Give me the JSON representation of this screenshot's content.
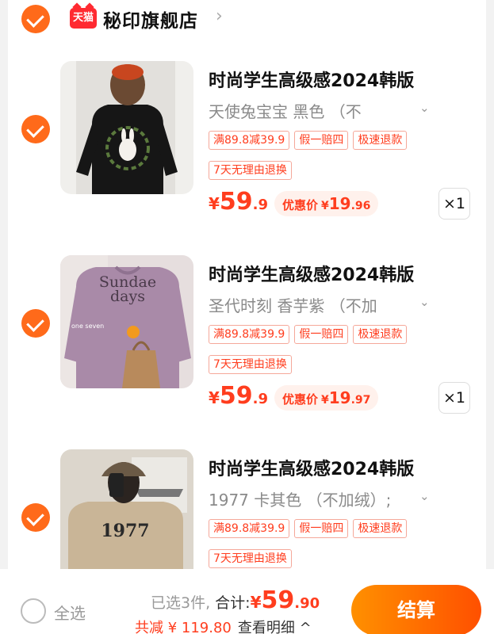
{
  "shop": {
    "name": "秘印旗舰店",
    "logo_text": "天猫"
  },
  "items": [
    {
      "title": "时尚学生高级感2024韩版",
      "sku": "天使兔宝宝  黑色  （不",
      "tags": [
        "满89.8减39.9",
        "假一赔四",
        "极速退款",
        "7天无理由退换"
      ],
      "price": {
        "currency": "¥",
        "int": "59",
        "dec": ".9"
      },
      "deal": {
        "label": "优惠价",
        "currency": "¥",
        "int": "19",
        "dec": ".96"
      },
      "qty": "×1",
      "image": {
        "shirt": "#161616",
        "bg": "#f0efec",
        "text": ""
      }
    },
    {
      "title": "时尚学生高级感2024韩版",
      "sku": "圣代时刻  香芋紫 （不加",
      "tags": [
        "满89.8减39.9",
        "假一赔四",
        "极速退款",
        "7天无理由退换"
      ],
      "price": {
        "currency": "¥",
        "int": "59",
        "dec": ".9"
      },
      "deal": {
        "label": "优惠价",
        "currency": "¥",
        "int": "19",
        "dec": ".97"
      },
      "qty": "×1",
      "image": {
        "shirt": "#a98aa8",
        "bg": "#e6dede",
        "text": "Sundae days",
        "caption": "one seven"
      }
    },
    {
      "title": "时尚学生高级感2024韩版",
      "sku": "1977 卡其色 （不加绒）;",
      "tags": [
        "满89.8减39.9",
        "假一赔四",
        "极速退款",
        "7天无理由退换"
      ],
      "image": {
        "shirt": "#c9b597",
        "bg": "#dcd6cc",
        "text": "1977"
      }
    }
  ],
  "footer": {
    "select_all": "全选",
    "selected_text": "已选3件,",
    "total_label": " 合计:",
    "total": {
      "currency": "¥",
      "int": "59",
      "dec": ".90"
    },
    "discount_text": "共减 ¥ 119.80",
    "detail_text": "查看明细 ^",
    "checkout_label": "结算"
  },
  "colors": {
    "accent": "#ff6a1a",
    "price": "#ff3d1e",
    "checkout_start": "#ff9000",
    "checkout_end": "#ff5000"
  }
}
